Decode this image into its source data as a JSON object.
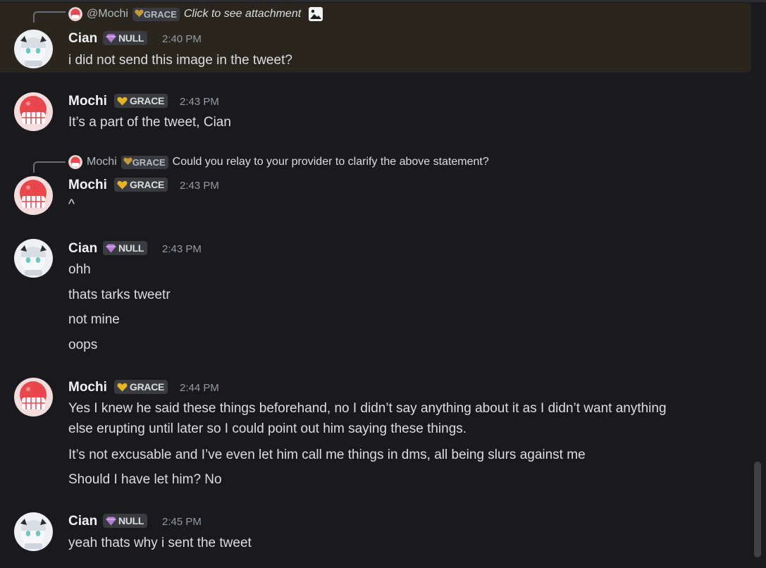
{
  "messages": [
    {
      "reply": {
        "author": "@Mochi",
        "badge": "GRACE",
        "text": "Click to see attachment"
      },
      "author": "Cian",
      "badge": "NULL",
      "time": "2:40 PM",
      "lines": [
        "i did not send this image in the tweet?"
      ]
    },
    {
      "author": "Mochi",
      "badge": "GRACE",
      "time": "2:43 PM",
      "lines": [
        "It’s a part of the tweet, Cian"
      ]
    },
    {
      "reply": {
        "author": "Mochi",
        "badge": "GRACE",
        "text": "Could you relay to your provider to clarify the above statement?"
      },
      "author": "Mochi",
      "badge": "GRACE",
      "time": "2:43 PM",
      "lines": [
        "^"
      ]
    },
    {
      "author": "Cian",
      "badge": "NULL",
      "time": "2:43 PM",
      "lines": [
        "ohh",
        "thats tarks tweetr",
        "not mine",
        "oops"
      ]
    },
    {
      "author": "Mochi",
      "badge": "GRACE",
      "time": "2:44 PM",
      "lines": [
        "Yes I knew he said these things beforehand, no I didn’t say anything about it as I didn’t want anything",
        "else erupting until later so I could point out him saying these things.",
        "It’s not excusable and I’ve even let him call me things in dms, all being slurs against me",
        "Should I have let him? No"
      ]
    },
    {
      "author": "Cian",
      "badge": "NULL",
      "time": "2:45 PM",
      "lines": [
        "yeah thats why i sent the tweet"
      ]
    }
  ]
}
